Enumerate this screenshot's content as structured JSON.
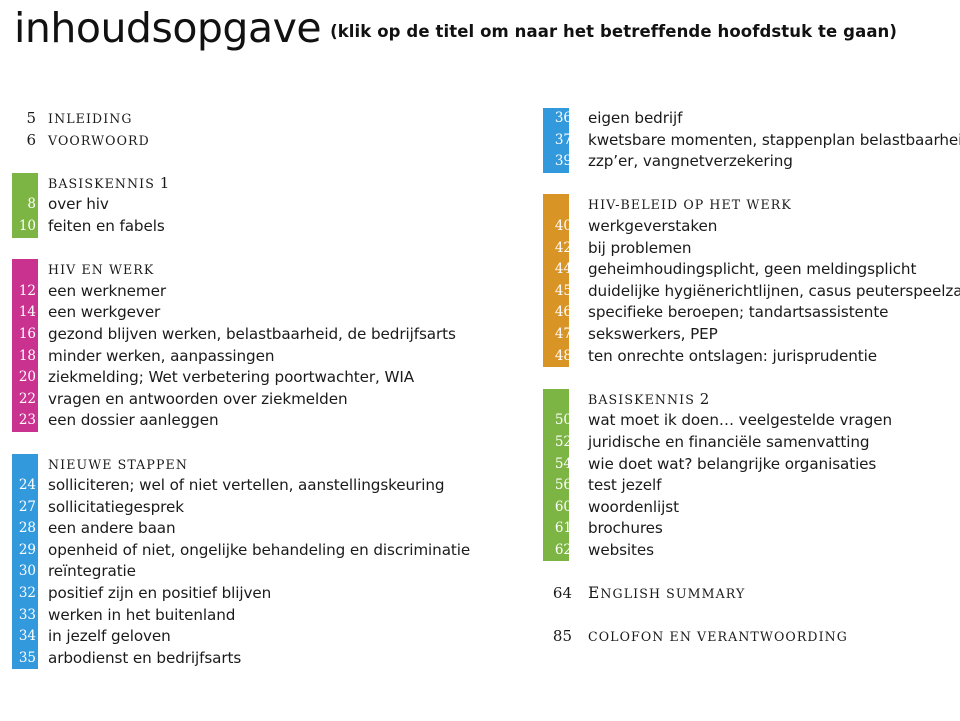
{
  "header": {
    "title": "inhoudsopgave",
    "subtitle": "(klik op de titel om naar het betreffende hoofdstuk te gaan)"
  },
  "colors": {
    "green": "#7CB544",
    "magenta": "#C9338F",
    "blue": "#3399DD",
    "orange": "#D99426",
    "text": "#1a1a1a",
    "number_on_bar": "#ffffff"
  },
  "left_column": {
    "groups": [
      {
        "name": "intro",
        "color": null,
        "rows": [
          {
            "num": "5",
            "label": "inleiding",
            "style": "smallcaps"
          },
          {
            "num": "6",
            "label": "voorwoord",
            "style": "smallcaps"
          }
        ]
      },
      {
        "name": "basiskennis-1",
        "color": "#7CB544",
        "rows": [
          {
            "num": "",
            "label": "basiskennis",
            "trailing": "1",
            "style": "head"
          },
          {
            "num": "8",
            "label": "over hiv",
            "style": "item"
          },
          {
            "num": "10",
            "label": "feiten en fabels",
            "style": "item"
          }
        ]
      },
      {
        "name": "hiv-en-werk",
        "color": "#C9338F",
        "rows": [
          {
            "num": "",
            "label": "hiv en werk",
            "style": "head"
          },
          {
            "num": "12",
            "label": "een werknemer",
            "style": "item"
          },
          {
            "num": "14",
            "label": "een werkgever",
            "style": "item"
          },
          {
            "num": "16",
            "label": "gezond blijven werken, belastbaarheid, de bedrijfsarts",
            "style": "item"
          },
          {
            "num": "18",
            "label": "minder werken, aanpassingen",
            "style": "item"
          },
          {
            "num": "20",
            "label": "ziekmelding; Wet verbetering poortwachter, WIA",
            "style": "item"
          },
          {
            "num": "22",
            "label": "vragen en antwoorden over ziekmelden",
            "style": "item"
          },
          {
            "num": "23",
            "label": "een dossier aanleggen",
            "style": "item"
          }
        ]
      },
      {
        "name": "nieuwe-stappen",
        "color": "#3399DD",
        "rows": [
          {
            "num": "",
            "label": "nieuwe stappen",
            "style": "head"
          },
          {
            "num": "24",
            "label": "solliciteren; wel of niet vertellen, aanstellingskeuring",
            "style": "item"
          },
          {
            "num": "27",
            "label": "sollicitatiegesprek",
            "style": "item"
          },
          {
            "num": "28",
            "label": "een andere baan",
            "style": "item"
          },
          {
            "num": "29",
            "label": "openheid of niet, ongelijke behandeling en discriminatie",
            "style": "item"
          },
          {
            "num": "30",
            "label": "reïntegratie",
            "style": "item"
          },
          {
            "num": "32",
            "label": "positief zijn en positief blijven",
            "style": "item"
          },
          {
            "num": "33",
            "label": "werken in het buitenland",
            "style": "item"
          },
          {
            "num": "34",
            "label": "in jezelf geloven",
            "style": "item"
          },
          {
            "num": "35",
            "label": "arbodienst en bedrijfsarts",
            "style": "item"
          }
        ]
      }
    ]
  },
  "right_column": {
    "groups": [
      {
        "name": "nieuwe-stappen-vervolg",
        "color": "#3399DD",
        "rows": [
          {
            "num": "36",
            "label": "eigen bedrijf",
            "style": "item"
          },
          {
            "num": "37",
            "label": "kwetsbare momenten, stappenplan belastbaarheid",
            "style": "item"
          },
          {
            "num": "39",
            "label": "zzp’er, vangnetverzekering",
            "style": "item"
          }
        ]
      },
      {
        "name": "hiv-beleid-op-het-werk",
        "color": "#D99426",
        "rows": [
          {
            "num": "",
            "label": "hiv-beleid op het werk",
            "style": "head"
          },
          {
            "num": "40",
            "label": "werkgeverstaken",
            "style": "item"
          },
          {
            "num": "42",
            "label": "bij problemen",
            "style": "item"
          },
          {
            "num": "44",
            "label": "geheimhoudingsplicht, geen meldingsplicht",
            "style": "item"
          },
          {
            "num": "45",
            "label": "duidelijke hygiënerichtlijnen, casus peuterspeelzaal",
            "style": "item"
          },
          {
            "num": "46",
            "label": "specifieke beroepen; tandartsassistente",
            "style": "item"
          },
          {
            "num": "47",
            "label": "sekswerkers, PEP",
            "style": "item"
          },
          {
            "num": "48",
            "label": "ten onrechte ontslagen: jurisprudentie",
            "style": "item"
          }
        ]
      },
      {
        "name": "basiskennis-2",
        "color": "#7CB544",
        "rows": [
          {
            "num": "",
            "label": "basiskennis",
            "trailing": "2",
            "style": "head"
          },
          {
            "num": "50",
            "label": "wat moet ik doen… veelgestelde vragen",
            "style": "item"
          },
          {
            "num": "52",
            "label": "juridische en financiële samenvatting",
            "style": "item"
          },
          {
            "num": "54",
            "label": "wie doet wat? belangrijke organisaties",
            "style": "item"
          },
          {
            "num": "56",
            "label": "test jezelf",
            "style": "item"
          },
          {
            "num": "60",
            "label": "woordenlijst",
            "style": "item"
          },
          {
            "num": "61",
            "label": "brochures",
            "style": "item"
          },
          {
            "num": "62",
            "label": "websites",
            "style": "item"
          }
        ]
      },
      {
        "name": "english-summary",
        "color": null,
        "rows": [
          {
            "num": "64",
            "label": "English summary",
            "style": "smallcaps-cap"
          }
        ]
      },
      {
        "name": "colofon",
        "color": null,
        "rows": [
          {
            "num": "85",
            "label": "colofon en verantwoording",
            "style": "smallcaps"
          }
        ]
      }
    ]
  }
}
